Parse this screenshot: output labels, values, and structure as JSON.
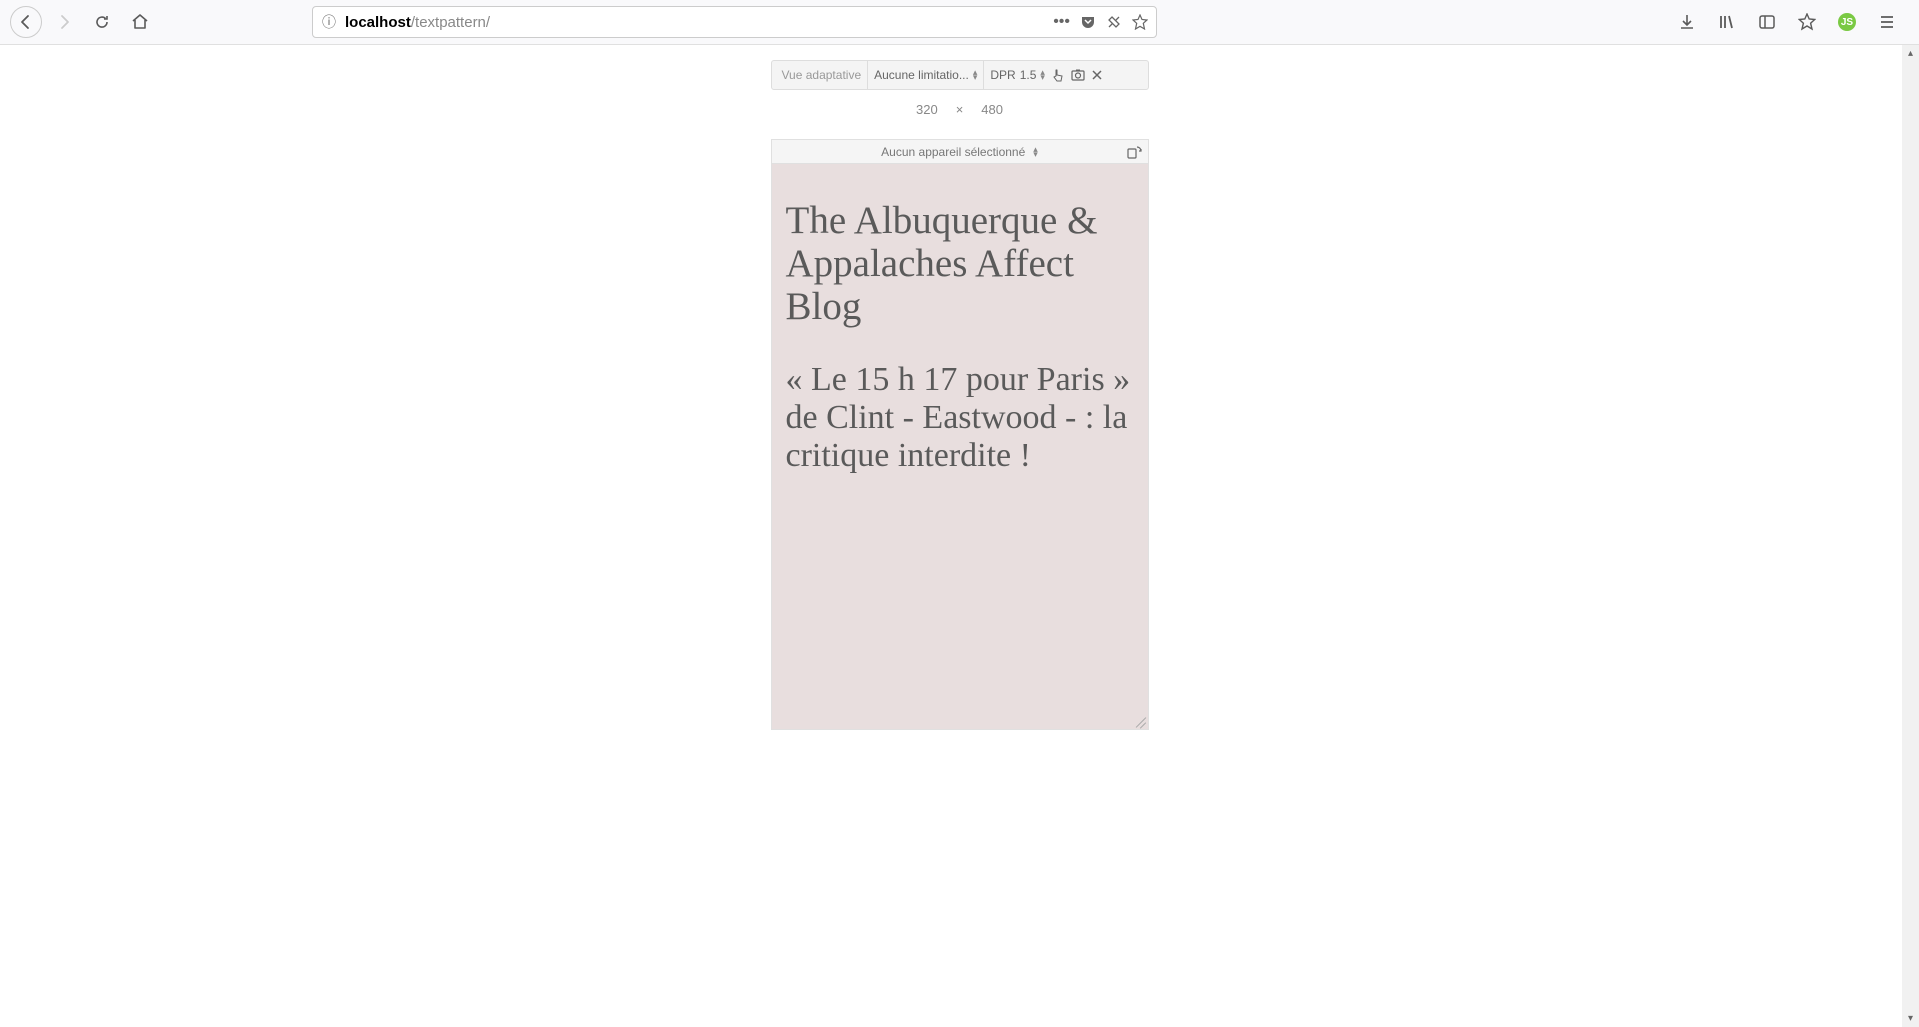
{
  "url": {
    "host": "localhost",
    "path": "/textpattern/"
  },
  "rdm": {
    "view_mode": "Vue adaptative",
    "throttle": "Aucune limitatio...",
    "dpr_label": "DPR",
    "dpr_value": "1.5",
    "width": "320",
    "height": "480",
    "dim_sep": "×",
    "device_selector": "Aucun appareil sélectionné"
  },
  "page": {
    "title": "The Albuquerque & Appalaches Affect Blog",
    "subtitle": "« Le 15 h 17 pour Paris » de Clint - Eastwood - : la critique interdite !"
  }
}
